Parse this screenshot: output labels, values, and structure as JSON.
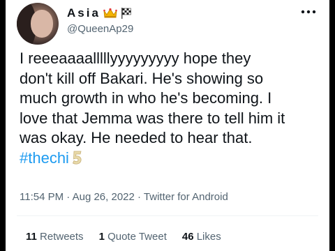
{
  "user": {
    "display_name": "Asia",
    "handle": "@QueenAp29",
    "badges": [
      "crown-emoji",
      "checkered-flag-emoji"
    ]
  },
  "tweet": {
    "lines": [
      "I reeeaaaalllllyyyyyyyyy hope they",
      "don't kill off Bakari. He's showing so",
      "much growth in who he's becoming. I",
      "love that Jemma was there to tell him it",
      "was okay. He needed to hear that."
    ],
    "hashtag": "#thechi",
    "hashtag_emoji": "number-five-emoji"
  },
  "meta": {
    "time": "11:54 PM",
    "sep1": " · ",
    "date": "Aug 26, 2022",
    "sep2": " · ",
    "source": "Twitter for Android"
  },
  "stats": {
    "retweets_count": "11",
    "retweets_label": "Retweets",
    "quotes_count": "1",
    "quotes_label": "Quote Tweet",
    "likes_count": "46",
    "likes_label": "Likes"
  },
  "colors": {
    "text": "#0f1419",
    "secondary": "#536471",
    "link": "#1d9bf0",
    "divider": "#eff3f4",
    "frame": "#000000"
  }
}
